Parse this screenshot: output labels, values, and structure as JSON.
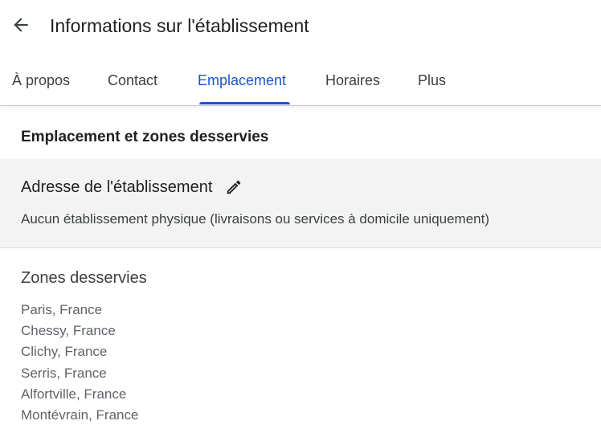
{
  "header": {
    "title": "Informations sur l'établissement",
    "back_icon": "arrow-left-icon"
  },
  "tabs": [
    {
      "label": "À propos",
      "active": false
    },
    {
      "label": "Contact",
      "active": false
    },
    {
      "label": "Emplacement",
      "active": true
    },
    {
      "label": "Horaires",
      "active": false
    },
    {
      "label": "Plus",
      "active": false
    }
  ],
  "section": {
    "title": "Emplacement et zones desservies"
  },
  "address": {
    "label": "Adresse de l'établissement",
    "value": "Aucun établissement physique (livraisons ou services à domicile uniquement)",
    "edit_icon": "pencil-icon"
  },
  "zones": {
    "title": "Zones desservies",
    "items": [
      "Paris, France",
      "Chessy, France",
      "Clichy, France",
      "Serris, France",
      "Alfortville, France",
      "Montévrain, France"
    ]
  },
  "colors": {
    "accent": "#1a56c4",
    "card_background": "#f3f3f3",
    "text_primary": "#202124",
    "text_secondary": "#5f6368"
  }
}
